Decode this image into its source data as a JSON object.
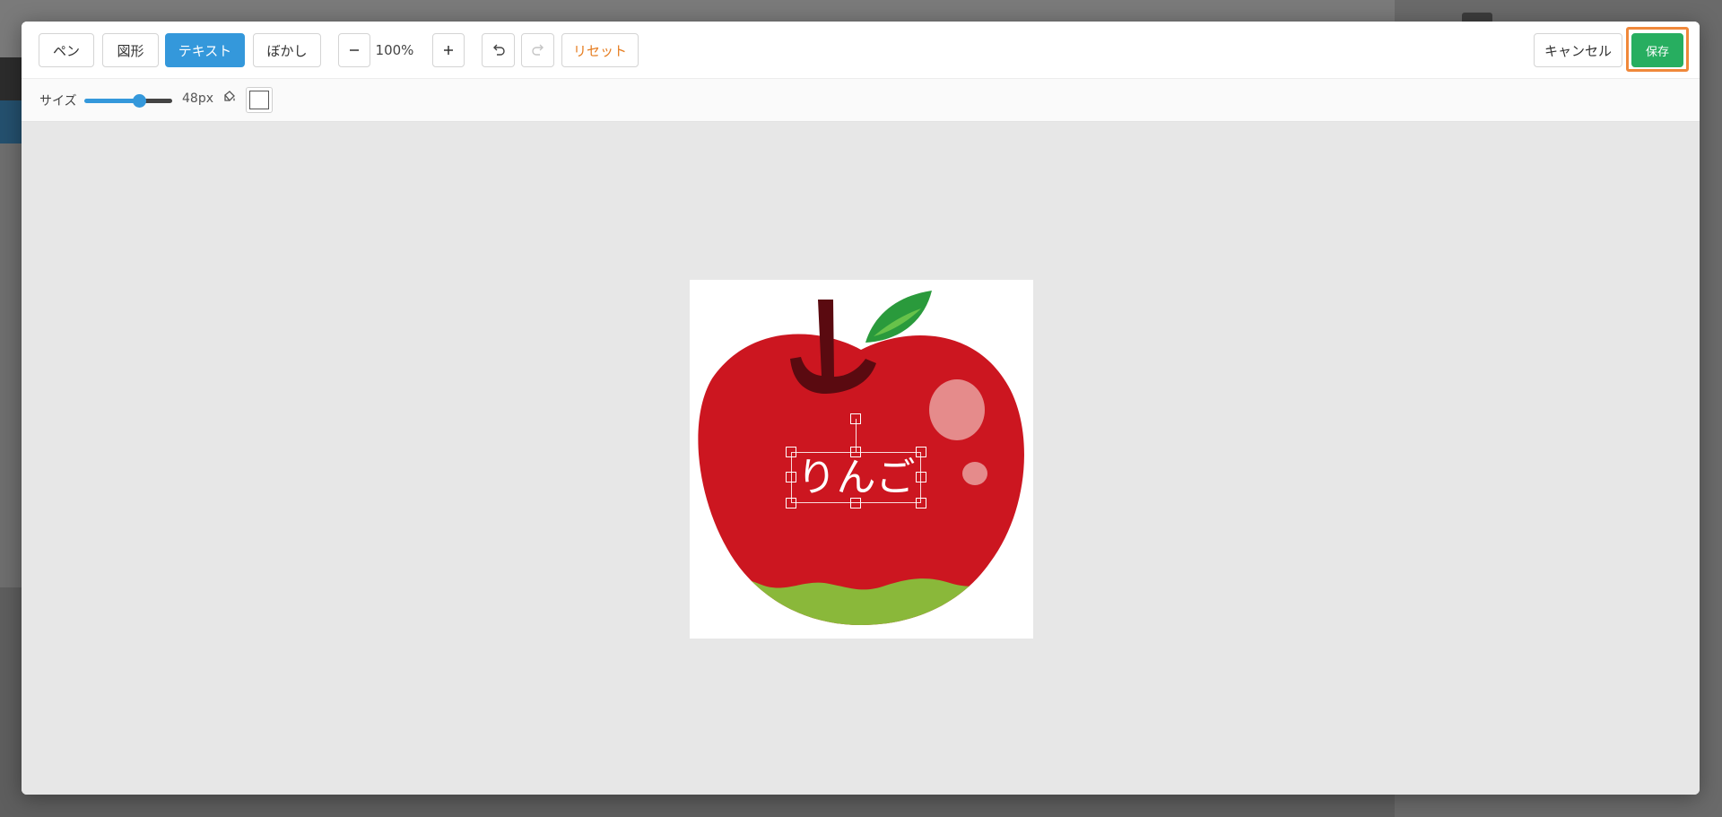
{
  "toolbar": {
    "tools": [
      {
        "label": "ペン",
        "active": false
      },
      {
        "label": "図形",
        "active": false
      },
      {
        "label": "テキスト",
        "active": true
      },
      {
        "label": "ぼかし",
        "active": false
      }
    ],
    "zoom_out_icon": "minus-icon",
    "zoom_level": "100%",
    "zoom_in_icon": "plus-icon",
    "undo_icon": "undo-icon",
    "redo_icon": "redo-icon",
    "reset_label": "リセット",
    "cancel_label": "キャンセル",
    "save_label": "保存"
  },
  "options": {
    "size_label": "サイズ",
    "size_value_percent": 62,
    "size_display": "48px",
    "color_icon": "paint-bucket-icon",
    "text_color": "#ffffff"
  },
  "canvas": {
    "text_object": "りんご"
  },
  "colors": {
    "active_tool": "#3498db",
    "save": "#27ae60",
    "reset_text": "#e67e22",
    "highlight_outline": "#f0883a",
    "apple_red": "#cc1620",
    "leaf_green": "#2a9a3c",
    "bottom_green": "#8ab83a"
  }
}
